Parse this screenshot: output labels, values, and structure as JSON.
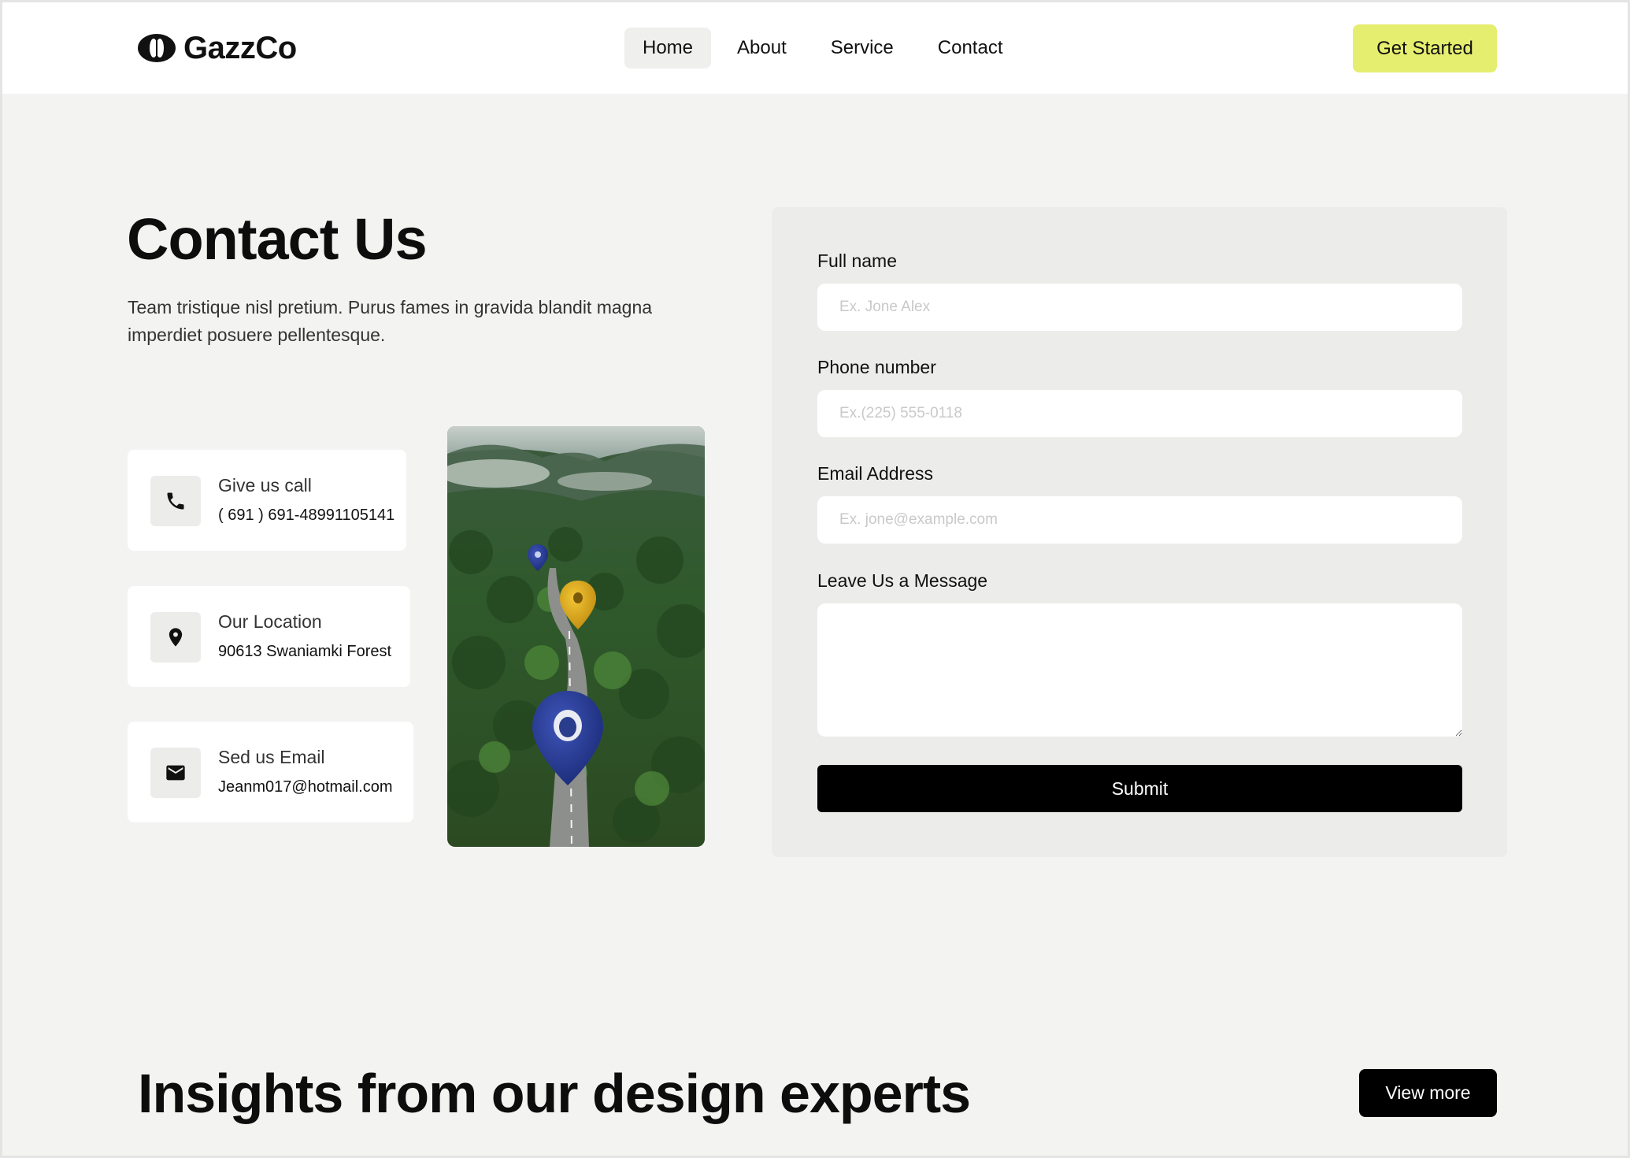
{
  "brand": {
    "name": "GazzCo",
    "accent": "#e6ee6f"
  },
  "nav": {
    "items": [
      {
        "label": "Home",
        "active": true
      },
      {
        "label": "About",
        "active": false
      },
      {
        "label": "Service",
        "active": false
      },
      {
        "label": "Contact",
        "active": false
      }
    ],
    "cta_label": "Get Started"
  },
  "contact": {
    "title": "Contact Us",
    "description": "Team tristique nisl pretium. Purus fames in gravida blandit magna imperdiet posuere pellentesque.",
    "cards": [
      {
        "icon": "phone-icon",
        "label": "Give us call",
        "value": "( 691 ) 691-48991105141"
      },
      {
        "icon": "location-pin-icon",
        "label": "Our Location",
        "value": "90613 Swaniamki Forest"
      },
      {
        "icon": "mail-icon",
        "label": "Sed us Email",
        "value": "Jeanm017@hotmail.com"
      }
    ]
  },
  "form": {
    "full_name_label": "Full name",
    "full_name_placeholder": "Ex. Jone Alex",
    "phone_label": "Phone number",
    "phone_placeholder": "Ex.(225) 555-0118",
    "email_label": "Email Address",
    "email_placeholder": "Ex. jone@example.com",
    "message_label": "Leave Us a Message",
    "submit_label": "Submit"
  },
  "insights": {
    "title": "Insights from our design experts",
    "view_more_label": "View more"
  }
}
